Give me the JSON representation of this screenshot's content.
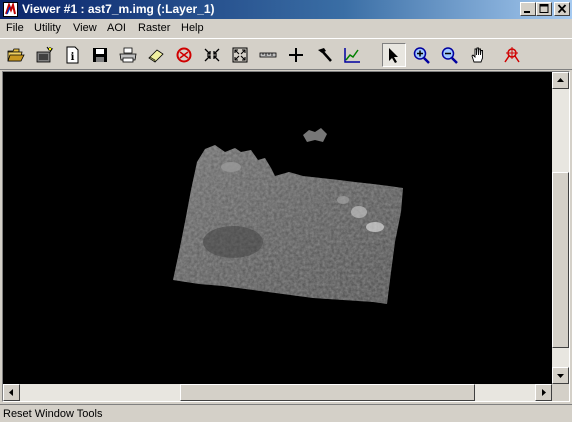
{
  "window": {
    "title": "Viewer #1 : ast7_m.img (:Layer_1)"
  },
  "menu": {
    "items": [
      {
        "label": "File"
      },
      {
        "label": "Utility"
      },
      {
        "label": "View"
      },
      {
        "label": "AOI"
      },
      {
        "label": "Raster"
      },
      {
        "label": "Help"
      }
    ]
  },
  "toolbar": {
    "tools": [
      {
        "icon": "open-folder-icon"
      },
      {
        "icon": "add-layer-icon"
      },
      {
        "icon": "layer-info-icon"
      },
      {
        "icon": "save-icon"
      },
      {
        "icon": "print-icon"
      },
      {
        "icon": "eraser-icon"
      },
      {
        "icon": "rotate-icon"
      },
      {
        "icon": "zoom-in-fixed-icon"
      },
      {
        "icon": "zoom-out-fixed-icon"
      },
      {
        "icon": "measure-icon"
      },
      {
        "icon": "inquire-cursor-icon"
      },
      {
        "icon": "hammer-icon"
      },
      {
        "icon": "profile-icon"
      },
      {
        "icon": "select-arrow-icon",
        "active": true
      },
      {
        "icon": "zoom-in-icon"
      },
      {
        "icon": "zoom-out-icon"
      },
      {
        "icon": "pan-hand-icon"
      },
      {
        "icon": "reset-window-tools-icon"
      }
    ]
  },
  "status": {
    "text": "Reset Window Tools"
  },
  "colors": {
    "titlebar_start": "#0a246a",
    "titlebar_end": "#a6caf0",
    "canvas_bg": "#000000",
    "face": "#d4d0c8"
  }
}
